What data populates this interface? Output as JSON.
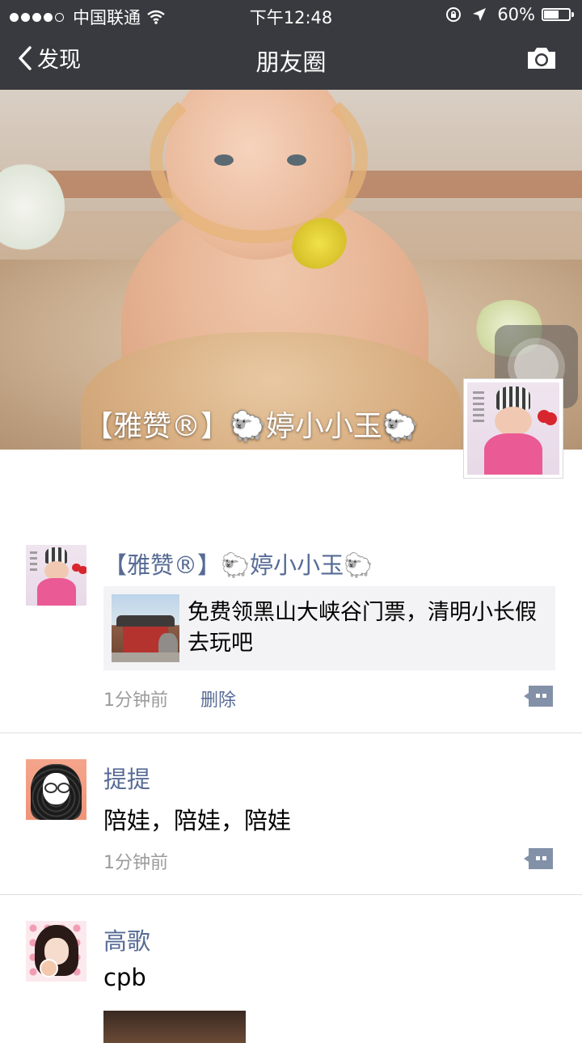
{
  "status_bar": {
    "carrier": "中国联通",
    "time": "下午12:48",
    "battery": "60%",
    "battery_level": 0.6,
    "signal_dots_filled": 4,
    "signal_dots_total": 5
  },
  "nav": {
    "back_label": "发现",
    "title": "朋友圈"
  },
  "cover": {
    "display_name": "【雅赞®】🐑婷小小玉🐑"
  },
  "posts": [
    {
      "name": "【雅赞®】🐑婷小小玉🐑",
      "link_text": "免费领黑山大峡谷门票，清明小长假去玩吧",
      "time": "1分钟前",
      "delete_label": "删除"
    },
    {
      "name": "提提",
      "text": "陪娃，陪娃，陪娃",
      "time": "1分钟前"
    },
    {
      "name": "高歌",
      "text": "cpb"
    }
  ],
  "colors": {
    "top_bar": "#393a3f",
    "name_link": "#576b95",
    "time_gray": "#9b9b9b",
    "card_bg": "#f3f3f5"
  },
  "icons": [
    "back-chevron-icon",
    "camera-icon",
    "wifi-icon",
    "lock-rotation-icon",
    "location-arrow-icon",
    "battery-icon",
    "comment-icon"
  ]
}
